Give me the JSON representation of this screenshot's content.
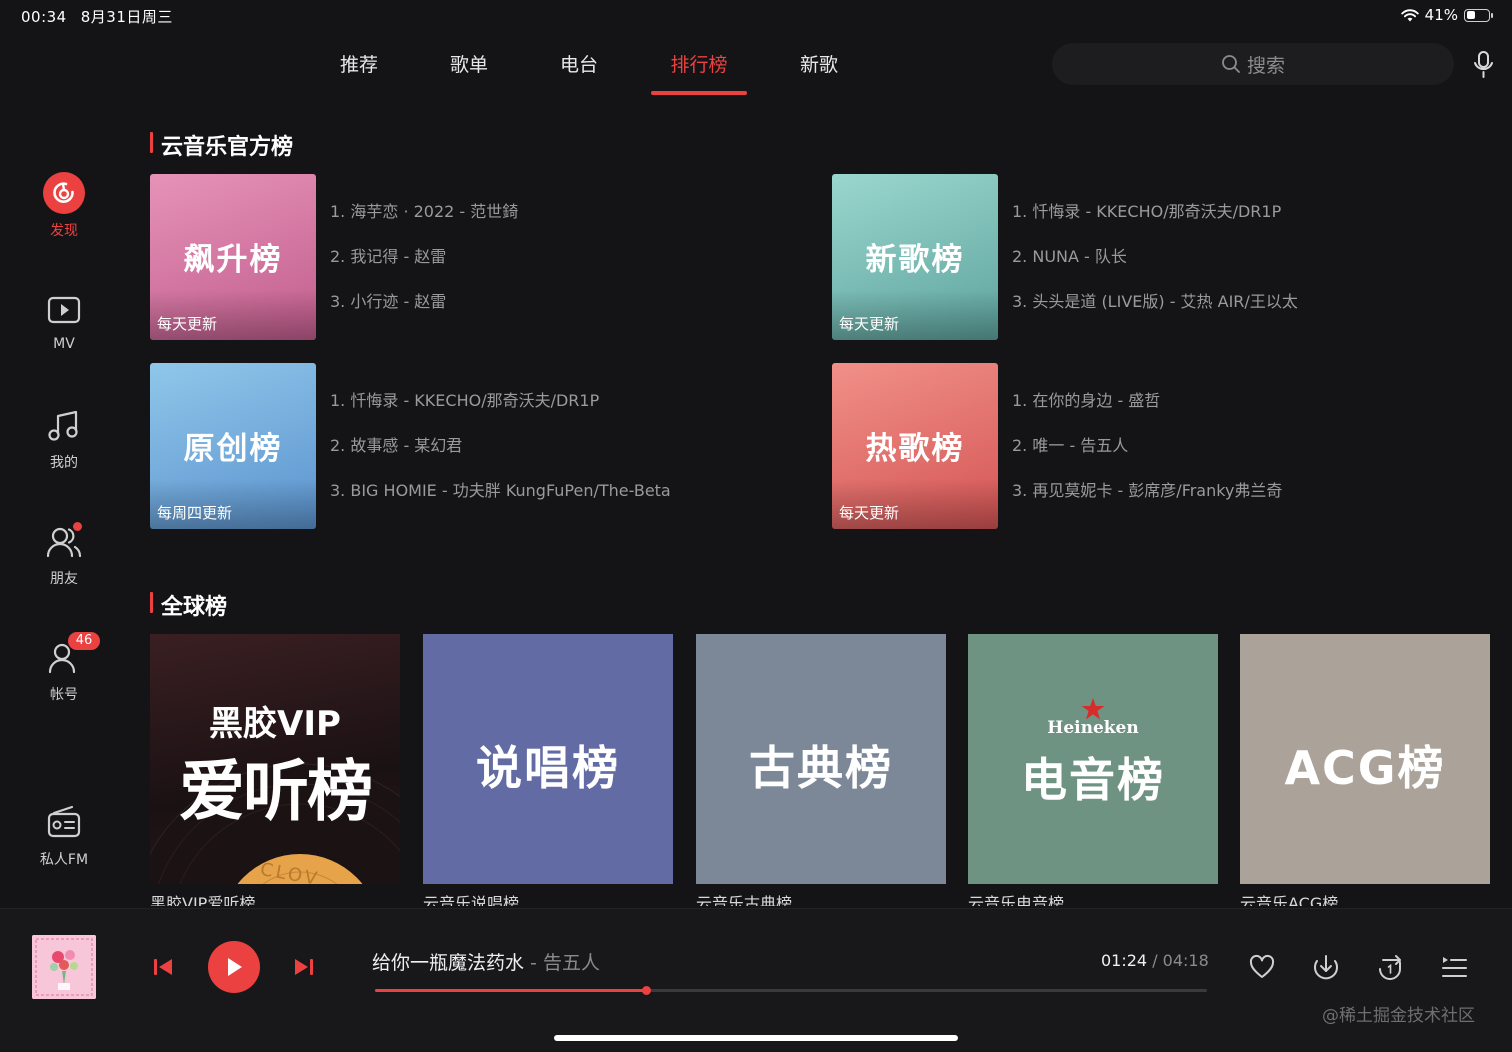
{
  "status_bar": {
    "time": "00:34",
    "date": "8月31日周三",
    "battery": "41%",
    "battery_level": 0.41
  },
  "nav": {
    "tabs": [
      {
        "label": "推荐",
        "active": false
      },
      {
        "label": "歌单",
        "active": false
      },
      {
        "label": "电台",
        "active": false
      },
      {
        "label": "排行榜",
        "active": true
      },
      {
        "label": "新歌",
        "active": false
      }
    ],
    "search_placeholder": "搜索"
  },
  "sidebar": {
    "items": [
      {
        "label": "发现",
        "icon": "netease-logo-icon",
        "active": true
      },
      {
        "label": "MV",
        "icon": "video-icon"
      },
      {
        "label": "我的",
        "icon": "music-note-icon"
      },
      {
        "label": "朋友",
        "icon": "friends-icon",
        "has_dot": true
      },
      {
        "label": "帐号",
        "icon": "account-icon",
        "badge": "46"
      },
      {
        "label": "私人FM",
        "icon": "radio-icon"
      }
    ]
  },
  "official": {
    "title": "云音乐官方榜",
    "charts": [
      {
        "name": "飙升榜",
        "update": "每天更新",
        "tracks": [
          "1. 海芋恋 · 2022 - 范世錡",
          "2. 我记得 - 赵雷",
          "3. 小行迹 - 赵雷"
        ]
      },
      {
        "name": "新歌榜",
        "update": "每天更新",
        "tracks": [
          "1. 忏悔录 - KKECHO/那奇沃夫/DR1P",
          "2. NUNA - 队长",
          "3. 头头是道 (LIVE版) - 艾热 AIR/王以太"
        ]
      },
      {
        "name": "原创榜",
        "update": "每周四更新",
        "tracks": [
          "1. 忏悔录 - KKECHO/那奇沃夫/DR1P",
          "2. 故事感 - 某幻君",
          "3. BIG HOMIE - 功夫胖 KungFuPen/The-Beta"
        ]
      },
      {
        "name": "热歌榜",
        "update": "每天更新",
        "tracks": [
          "1. 在你的身边 - 盛哲",
          "2. 唯一 - 告五人",
          "3. 再见莫妮卡 - 彭席彦/Franky弗兰奇"
        ]
      }
    ]
  },
  "global": {
    "title": "全球榜",
    "charts": [
      {
        "cover_top": "黑胶VIP",
        "cover_name": "爱听榜",
        "cover_disc": "CLOV",
        "label": "黑胶VIP爱听榜"
      },
      {
        "cover_name": "说唱榜",
        "label": "云音乐说唱榜"
      },
      {
        "cover_name": "古典榜",
        "label": "云音乐古典榜"
      },
      {
        "cover_top": "Heineken",
        "cover_name": "电音榜",
        "label": "云音乐电音榜"
      },
      {
        "cover_name": "ACG榜",
        "label": "云音乐ACG榜"
      }
    ]
  },
  "player": {
    "song": "给你一瓶魔法药水",
    "artist": "告五人",
    "artist_sep": " - ",
    "current_time": "01:24",
    "total_time": "04:18",
    "time_sep": " / ",
    "progress": 0.326
  },
  "watermark": "@稀土掘金技术社区",
  "colors": {
    "accent": "#ec4141",
    "background": "#141416",
    "player_bg": "#18181a"
  }
}
